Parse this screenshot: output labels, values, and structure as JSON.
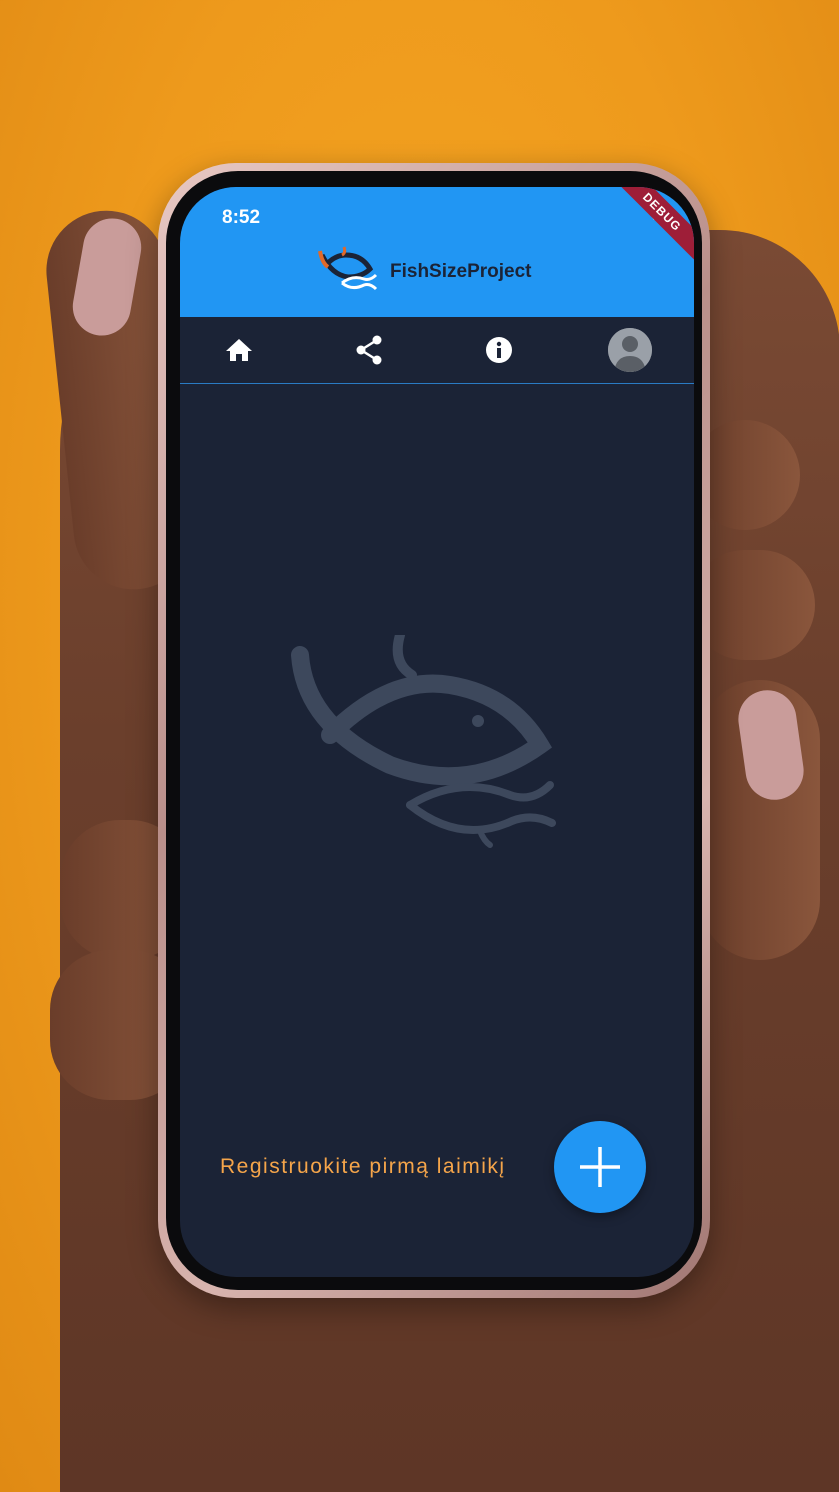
{
  "status_bar": {
    "time": "8:52",
    "debug_banner": "DEBUG"
  },
  "app_bar": {
    "title": "FishSizeProject"
  },
  "nav": {
    "items": [
      {
        "icon": "home-icon"
      },
      {
        "icon": "share-icon"
      },
      {
        "icon": "info-icon"
      },
      {
        "icon": "avatar-icon"
      }
    ]
  },
  "main": {
    "empty_state_text": "Registruokite pirmą laimikį"
  },
  "colors": {
    "app_bar": "#2196f3",
    "screen_bg": "#1b2336",
    "accent_text": "#f5a54a",
    "background": "#f5a623"
  }
}
